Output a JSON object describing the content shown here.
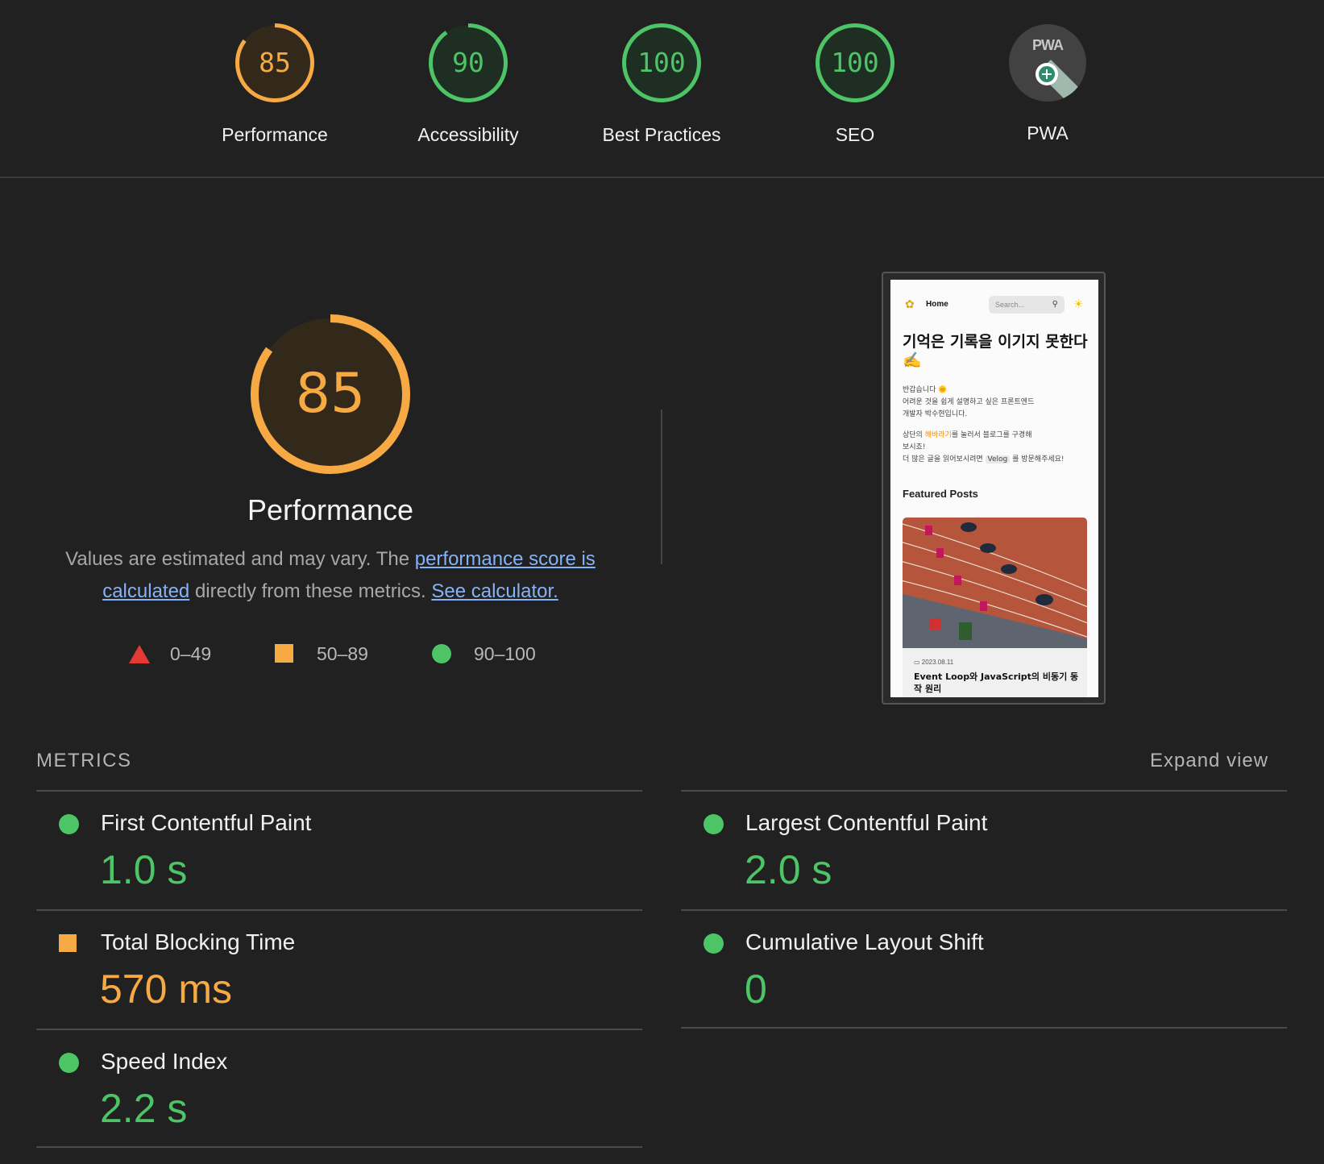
{
  "categories": [
    {
      "score": "85",
      "label": "Performance",
      "color": "#f7aa43",
      "fraction": 0.85
    },
    {
      "score": "90",
      "label": "Accessibility",
      "color": "#4dc566",
      "fraction": 0.9
    },
    {
      "score": "100",
      "label": "Best Practices",
      "color": "#4dc566",
      "fraction": 1.0
    },
    {
      "score": "100",
      "label": "SEO",
      "color": "#4dc566",
      "fraction": 1.0
    },
    {
      "badge": "PWA",
      "label": "PWA"
    }
  ],
  "performance": {
    "score": "85",
    "fraction": 0.85,
    "title": "Performance",
    "desc_prefix": "Values are estimated and may vary. The ",
    "score_link": "performance score is calculated",
    "desc_middle": " directly from these metrics. ",
    "calc_link": "See calculator."
  },
  "legend": {
    "fail": "0–49",
    "average": "50–89",
    "pass": "90–100"
  },
  "preview": {
    "nav_home": "Home",
    "search_placeholder": "Search...",
    "headline": "기억은 기록을 이기지 못한다✍️",
    "intro_line1": "반갑습니다 🌞",
    "intro_line2": "어려운 것을 쉽게 설명하고 싶은 프론트엔드",
    "intro_line3": "개발자 박수현입니다.",
    "guide_prefix": "상단의 ",
    "guide_highlight": "해바라기",
    "guide_suffix": "를 눌러서 블로그를 구경해",
    "guide_line2": "보시죠!",
    "velog_prefix": "더 많은 글을 읽어보시려면 ",
    "velog_chip": "Velog",
    "velog_suffix": " 를 방문해주세요!",
    "featured": "Featured Posts",
    "post_date": "2023.08.11",
    "post_title": "Event Loop와 JavaScript의 비동기 동작 원리"
  },
  "metrics_section": {
    "heading": "METRICS",
    "expand": "Expand view"
  },
  "metrics": [
    {
      "name": "First Contentful Paint",
      "value": "1.0 s",
      "rating": "pass"
    },
    {
      "name": "Largest Contentful Paint",
      "value": "2.0 s",
      "rating": "pass"
    },
    {
      "name": "Total Blocking Time",
      "value": "570 ms",
      "rating": "average"
    },
    {
      "name": "Cumulative Layout Shift",
      "value": "0",
      "rating": "pass"
    },
    {
      "name": "Speed Index",
      "value": "2.2 s",
      "rating": "pass"
    }
  ],
  "colors": {
    "pass": "#4dc566",
    "average": "#f7aa43",
    "fail": "#e53935",
    "link": "#86b3f7",
    "background": "#212121"
  }
}
